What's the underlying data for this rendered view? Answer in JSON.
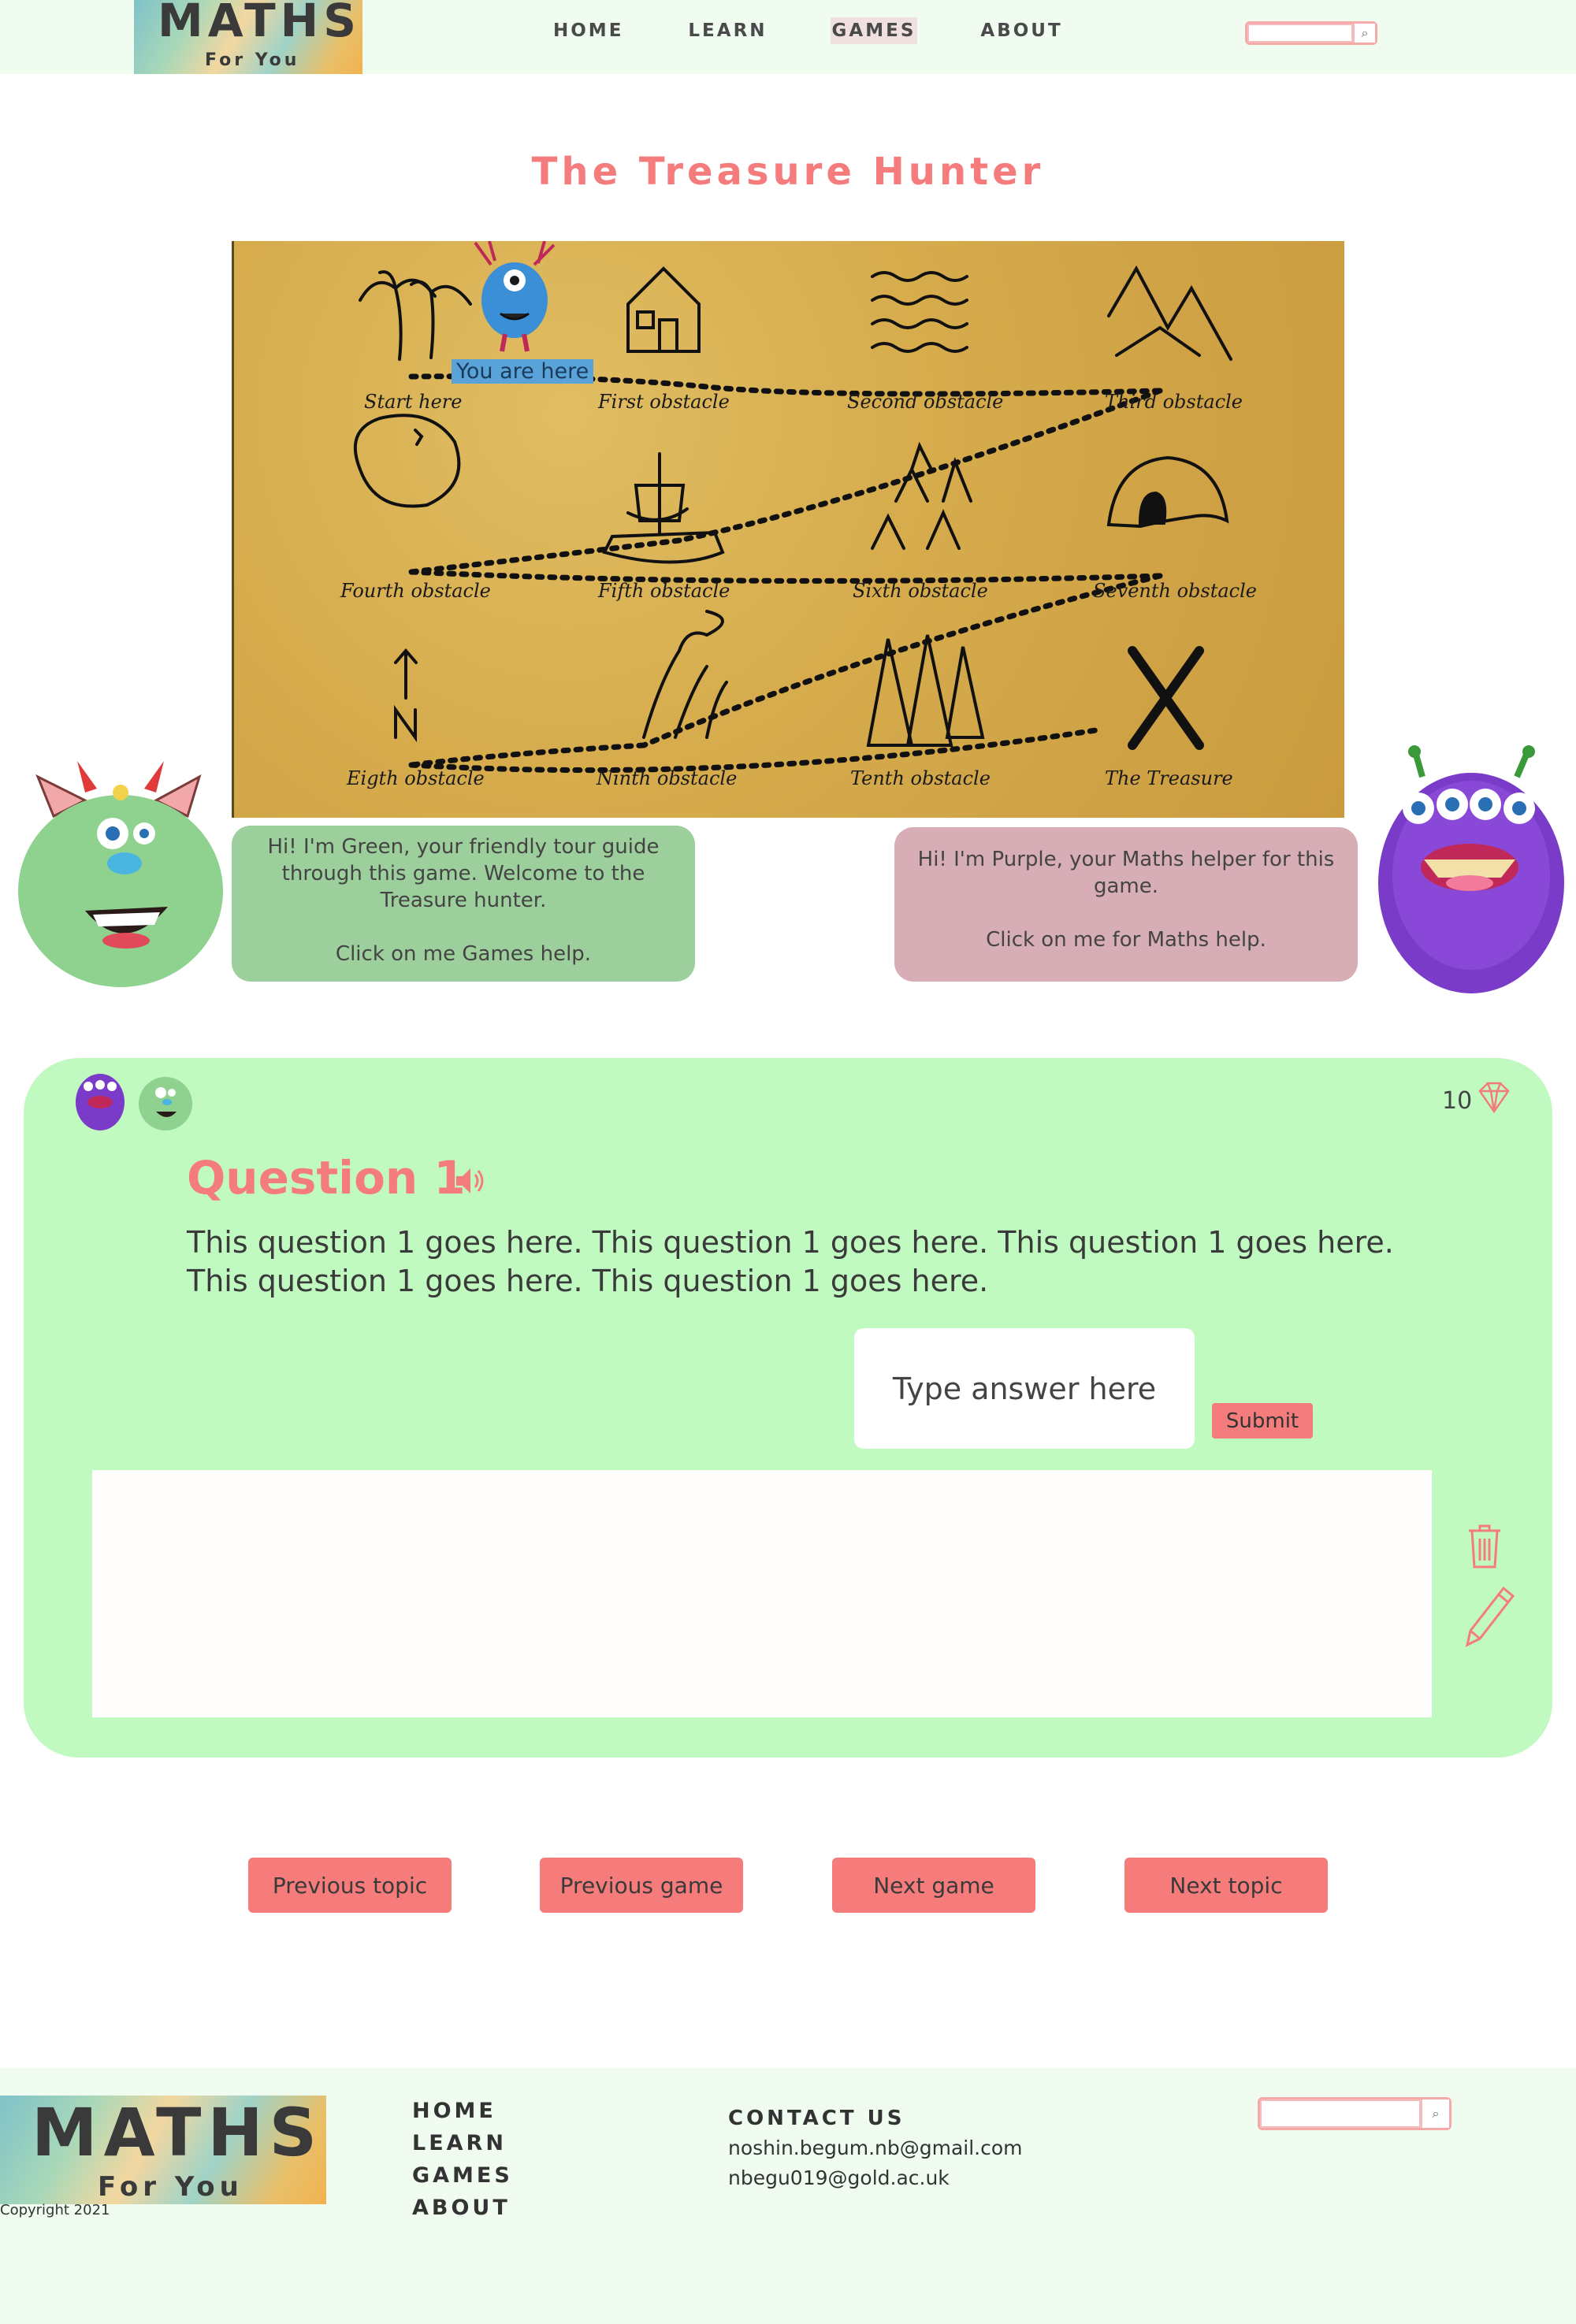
{
  "header": {
    "logo_main": "MATHS",
    "logo_sub": "For You",
    "nav": [
      {
        "label": "HOME"
      },
      {
        "label": "LEARN"
      },
      {
        "label": "GAMES",
        "active": true
      },
      {
        "label": "ABOUT"
      }
    ],
    "search_icon": "magnifier-icon"
  },
  "page_title": "The Treasure Hunter",
  "map": {
    "you_are_here": "You are here",
    "locations": [
      "Start here",
      "First obstacle",
      "Second obstacle",
      "Third obstacle",
      "Fourth obstacle",
      "Fifth obstacle",
      "Sixth obstacle",
      "Seventh obstacle",
      "Eigth obstacle",
      "Ninth obstacle",
      "Tenth obstacle",
      "The Treasure"
    ]
  },
  "green_guide": {
    "line1": "Hi! I'm Green, your friendly tour guide through this game. Welcome to the Treasure hunter.",
    "line2": "Click on me Games help."
  },
  "purple_guide": {
    "line1": "Hi! I'm Purple, your Maths helper for this game.",
    "line2": "Click on me for Maths help."
  },
  "question": {
    "title": "Question 1",
    "text": "This question 1 goes here. This question 1 goes here. This question 1 goes here. This question 1 goes here. This question 1 goes here.",
    "answer_placeholder": "Type answer here",
    "submit_label": "Submit",
    "score": "10",
    "icons": [
      "speaker-icon",
      "gem-icon",
      "trash-icon",
      "pencil-icon"
    ]
  },
  "nav_buttons": [
    "Previous topic",
    "Previous game",
    "Next game",
    "Next topic"
  ],
  "footer": {
    "logo_main": "MATHS",
    "logo_sub": "For You",
    "copyright": "Copyright 2021",
    "nav": [
      "HOME",
      "LEARN",
      "GAMES",
      "ABOUT"
    ],
    "contact_heading": "CONTACT US",
    "emails": [
      "noshin.begum.nb@gmail.com",
      "nbegu019@gold.ac.uk"
    ]
  },
  "colors": {
    "accent": "#f47c7c",
    "panel": "#c1fac1",
    "header_bg": "#f0fcf0",
    "green_bubble": "#9ccf9c",
    "pink_bubble": "#d7aeb6"
  }
}
